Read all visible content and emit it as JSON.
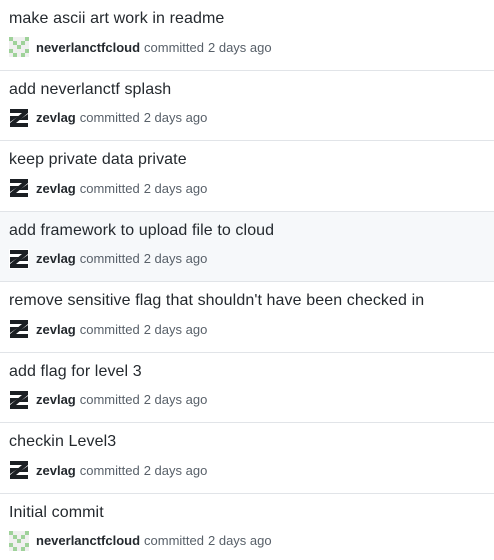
{
  "commits": [
    {
      "message": "make ascii art work in readme",
      "author": "neverlanctfcloud",
      "avatar": "identicon-avatar",
      "verb": "committed",
      "time": "2 days ago"
    },
    {
      "message": "add neverlanctf splash",
      "author": "zevlag",
      "avatar": "z-logo-avatar",
      "verb": "committed",
      "time": "2 days ago"
    },
    {
      "message": "keep private data private",
      "author": "zevlag",
      "avatar": "z-logo-avatar",
      "verb": "committed",
      "time": "2 days ago"
    },
    {
      "message": "add framework to upload file to cloud",
      "author": "zevlag",
      "avatar": "z-logo-avatar",
      "verb": "committed",
      "time": "2 days ago"
    },
    {
      "message": "remove sensitive flag that shouldn't have been checked in",
      "author": "zevlag",
      "avatar": "z-logo-avatar",
      "verb": "committed",
      "time": "2 days ago"
    },
    {
      "message": "add flag for level 3",
      "author": "zevlag",
      "avatar": "z-logo-avatar",
      "verb": "committed",
      "time": "2 days ago"
    },
    {
      "message": "checkin Level3",
      "author": "zevlag",
      "avatar": "z-logo-avatar",
      "verb": "committed",
      "time": "2 days ago"
    },
    {
      "message": "Initial commit",
      "author": "neverlanctfcloud",
      "avatar": "identicon-avatar",
      "verb": "committed",
      "time": "2 days ago"
    }
  ],
  "colors": {
    "identicon": "#9fd29a",
    "hover_row": "#f6f8fa"
  }
}
